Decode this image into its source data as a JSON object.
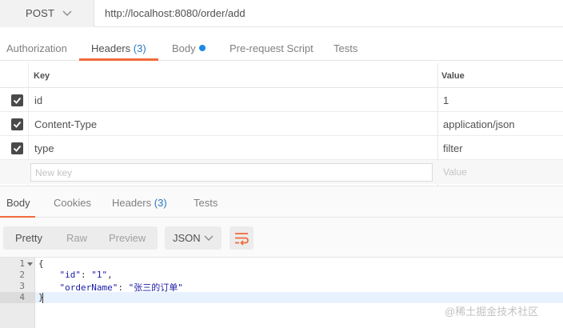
{
  "request": {
    "method": "POST",
    "url": "http://localhost:8080/order/add"
  },
  "request_tabs": {
    "authorization": "Authorization",
    "headers": "Headers",
    "headers_count": "(3)",
    "body": "Body",
    "prerequest": "Pre-request Script",
    "tests": "Tests"
  },
  "headers_table": {
    "key_col": "Key",
    "value_col": "Value",
    "rows": [
      {
        "key": "id",
        "value": "1",
        "checked": true
      },
      {
        "key": "Content-Type",
        "value": "application/json",
        "checked": true
      },
      {
        "key": "type",
        "value": "filter",
        "checked": true
      }
    ],
    "new_key_placeholder": "New key",
    "new_value_placeholder": "Value"
  },
  "response_tabs": {
    "body": "Body",
    "cookies": "Cookies",
    "headers": "Headers",
    "headers_count": "(3)",
    "tests": "Tests"
  },
  "toolbar": {
    "pretty": "Pretty",
    "raw": "Raw",
    "preview": "Preview",
    "format": "JSON"
  },
  "editor": {
    "line_numbers": [
      "1",
      "2",
      "3",
      "4"
    ],
    "lines": {
      "l1": "{",
      "l2_key": "\"id\"",
      "l2_sep": ": ",
      "l2_val": "\"1\"",
      "l2_end": ",",
      "l3_key": "\"orderName\"",
      "l3_sep": ": ",
      "l3_val": "\"张三的订单\"",
      "l4": "}"
    }
  },
  "watermark": "@稀土掘金技术社区",
  "colors": {
    "accent": "#f26b3a",
    "count_blue": "#2a78c2",
    "body_dot": "#1e88e5",
    "json_value": "#1a1aa6"
  }
}
